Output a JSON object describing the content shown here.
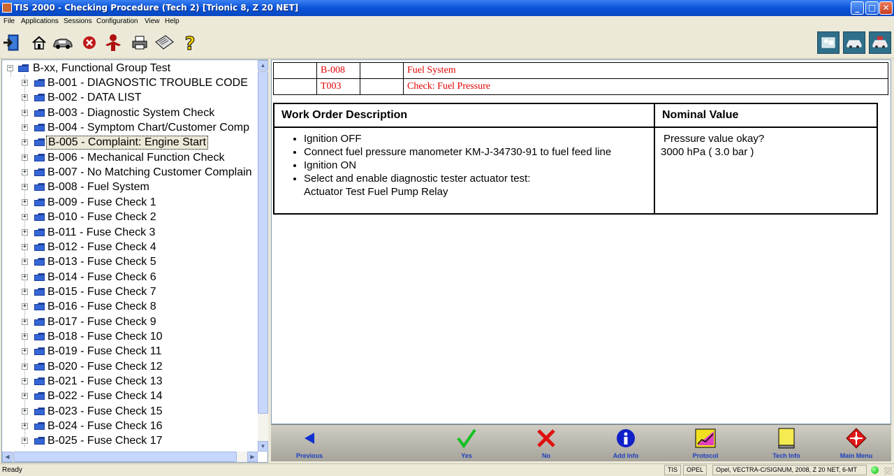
{
  "window": {
    "title": "TIS 2000 - Checking Procedure (Tech 2) [Trionic 8, Z 20 NET]",
    "min": "_",
    "max": "□",
    "close": "✕"
  },
  "menu": [
    "File",
    "Applications",
    "Sessions",
    "Configuration",
    "View",
    "Help"
  ],
  "toolbar": {
    "left_icons": [
      "exit-icon",
      "home-icon",
      "vehicle-icon",
      "stop-icon",
      "user-icon",
      "print-icon",
      "notepad-icon",
      "help-icon"
    ],
    "right_icons": [
      "technician-icon",
      "vehicle-diagnostic-icon",
      "car-data-icon"
    ]
  },
  "tree": {
    "root": "B-xx, Functional Group Test",
    "items": [
      "B-001 - DIAGNOSTIC TROUBLE CODE",
      "B-002 - DATA LIST",
      "B-003 - Diagnostic System Check",
      "B-004 - Symptom Chart/Customer Comp",
      "B-005 - Complaint: Engine Start",
      "B-006 - Mechanical Function Check",
      "B-007 - No Matching Customer Complain",
      "B-008 - Fuel System",
      "B-009 - Fuse Check 1",
      "B-010 - Fuse Check 2",
      "B-011 - Fuse Check 3",
      "B-012 - Fuse Check 4",
      "B-013 - Fuse Check 5",
      "B-014 - Fuse Check 6",
      "B-015 - Fuse Check 7",
      "B-016 - Fuse Check 8",
      "B-017 - Fuse Check 9",
      "B-018 - Fuse Check 10",
      "B-019 - Fuse Check 11",
      "B-020 - Fuse Check 12",
      "B-021 - Fuse Check 13",
      "B-022 - Fuse Check 14",
      "B-023 - Fuse Check 15",
      "B-024 - Fuse Check 16",
      "B-025 - Fuse Check 17"
    ],
    "selected_index": 4
  },
  "header_rows": [
    {
      "code": "B-008",
      "title": "Fuel System"
    },
    {
      "code": "T003",
      "title": "Check: Fuel Pressure"
    }
  ],
  "work_order": {
    "col1_header": "Work Order Description",
    "col2_header": "Nominal Value",
    "steps": [
      "Ignition OFF",
      "Connect fuel pressure manometer KM-J-34730-91 to fuel feed line",
      "Ignition ON",
      "Select and enable diagnostic tester actuator test:"
    ],
    "step_continuation": "Actuator Test Fuel Pump Relay",
    "nominal_line1": "Pressure value okay?",
    "nominal_line2": "3000 hPa ( 3.0 bar )"
  },
  "nav_buttons": [
    {
      "label": "Previous",
      "icon": "previous-icon"
    },
    {
      "label": "Yes",
      "icon": "yes-checkmark-icon"
    },
    {
      "label": "No",
      "icon": "no-cross-icon"
    },
    {
      "label": "Add Info",
      "icon": "info-icon"
    },
    {
      "label": "Protocol",
      "icon": "protocol-icon"
    },
    {
      "label": "Tech Info",
      "icon": "tech-info-icon"
    },
    {
      "label": "Main Menu",
      "icon": "main-menu-icon"
    }
  ],
  "status": {
    "ready": "Ready",
    "system": "TIS",
    "brand": "OPEL",
    "vehicle": "Opel, VECTRA-C/SIGNUM, 2008, Z 20 NET, 6-MT"
  },
  "colors": {
    "accent": "#0a53d8",
    "header_text": "#e00000",
    "nav_label": "#1f3fbf",
    "status_led": "#00bb00"
  }
}
